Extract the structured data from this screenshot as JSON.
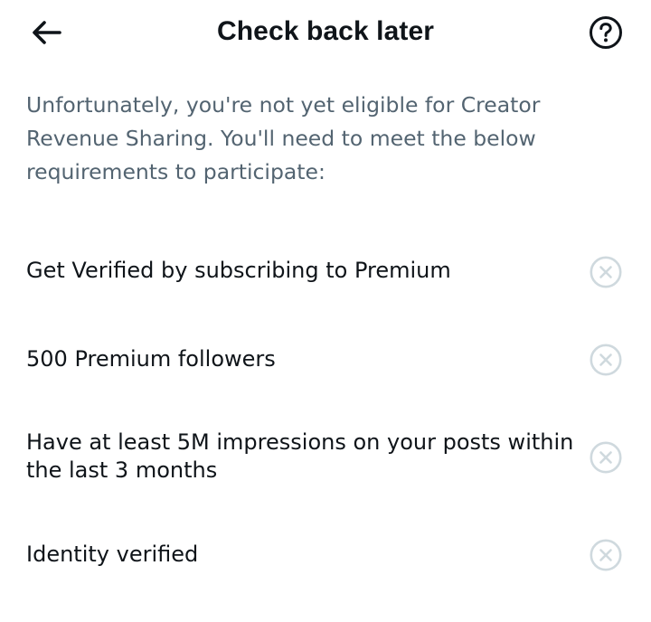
{
  "header": {
    "title": "Check back later",
    "back_icon": "arrow-left-icon",
    "help_icon": "question-circle-icon"
  },
  "intro": {
    "text": "Unfortunately, you're not yet eligible for Creator Revenue Sharing. You'll need to meet the below requirements to participate:"
  },
  "requirements": [
    {
      "label": "Get Verified by subscribing to Premium",
      "status": "not-met",
      "status_icon": "x-circle-icon"
    },
    {
      "label": "500 Premium followers",
      "status": "not-met",
      "status_icon": "x-circle-icon"
    },
    {
      "label": "Have at least 5M impressions on your posts within the last 3 months",
      "status": "not-met",
      "status_icon": "x-circle-icon"
    },
    {
      "label": "Identity verified",
      "status": "not-met",
      "status_icon": "x-circle-icon"
    }
  ],
  "colors": {
    "text_primary": "#0f1419",
    "text_secondary": "#536471",
    "status_icon": "#cfd9de"
  }
}
